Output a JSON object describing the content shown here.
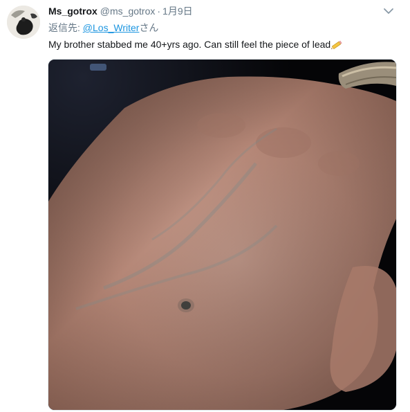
{
  "tweet": {
    "author_name": "Ms_gotrox",
    "author_handle": "@ms_gotrox",
    "separator": "·",
    "date": "1月9日",
    "reply_prefix": "返信先: ",
    "reply_mention": "@Los_Writer",
    "reply_suffix": "さん",
    "text": "My brother stabbed me 40+yrs ago. Can still feel the piece of lead",
    "icons": {
      "avatar": "avatar-icon",
      "more": "chevron-down-icon",
      "emoji": "pencil-emoji-icon"
    }
  }
}
